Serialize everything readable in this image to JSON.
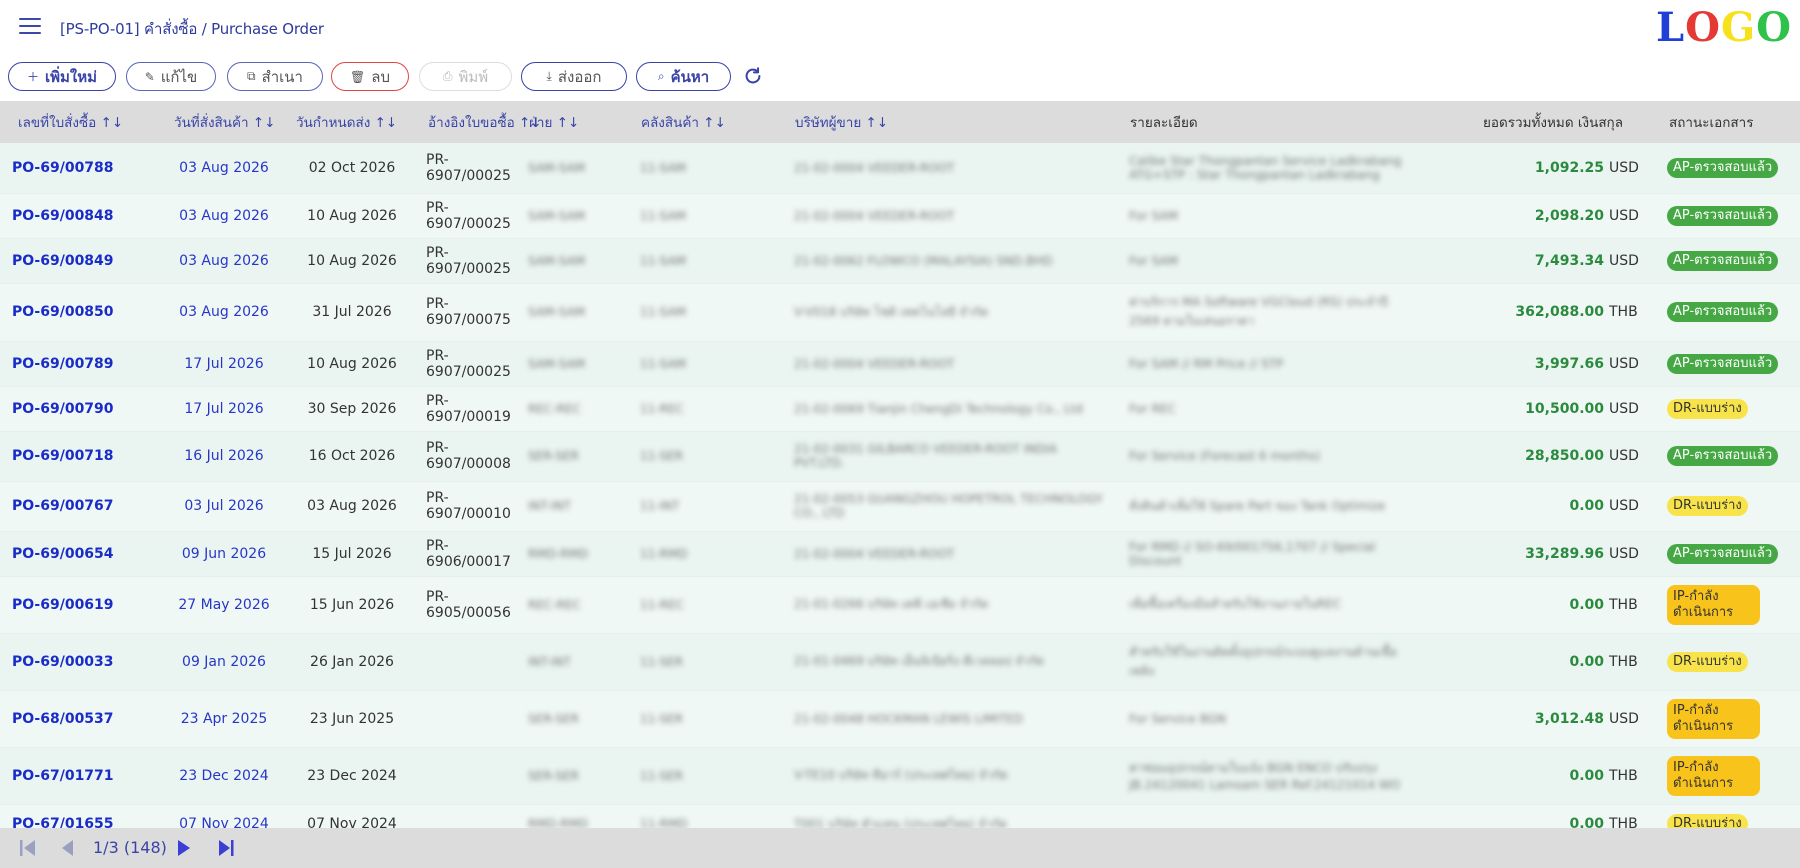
{
  "header": {
    "title": "[PS-PO-01] คำสั่งซื้อ / Purchase Order",
    "logo_letters": [
      "L",
      "O",
      "G",
      "O"
    ],
    "logo_colors": [
      "#1f3fd6",
      "#e53935",
      "#f7e11a",
      "#2fc24a"
    ]
  },
  "toolbar": {
    "add_label": "เพิ่มใหม่",
    "edit_label": "แก้ไข",
    "copy_label": "สำเนา",
    "delete_label": "ลบ",
    "print_label": "พิมพ์",
    "export_label": "ส่งออก",
    "search_label": "ค้นหา"
  },
  "table": {
    "columns": [
      "เลขที่ใบสั่งซื้อ ↑↓",
      "วันที่สั่งสินค้า ↑↓",
      "วันกำหนดส่ง ↑↓",
      "อ้างอิงใบขอซื้อ ↑↓",
      "ฝ่าย ↑↓",
      "คลังสินค้า ↑↓",
      "บริษัทผู้ขาย ↑↓",
      "รายละเอียด",
      "ยอดรวมทั้งหมด เงินสกุล",
      "สถานะเอกสาร"
    ],
    "rows": [
      {
        "po": "PO-69/00788",
        "date": "03 Aug 2026",
        "due": "02 Oct 2026",
        "pr": "PR-6907/00025",
        "dept": "SAM-SAM",
        "wh": "11-SAM",
        "vendor": "21-02-0004 VEEDER-ROOT",
        "detail": "Calibe Star Thongpantan Service Ladkrabang ATG+STP : Star Thongpantan Ladkrabang",
        "amount": "1,092.25",
        "cur": "USD",
        "status": "AP-ตรวจสอบแล้ว",
        "stype": "ap"
      },
      {
        "po": "PO-69/00848",
        "date": "03 Aug 2026",
        "due": "10 Aug 2026",
        "pr": "PR-6907/00025",
        "dept": "SAM-SAM",
        "wh": "11-SAM",
        "vendor": "21-02-0004 VEEDER-ROOT",
        "detail": "For SAM",
        "amount": "2,098.20",
        "cur": "USD",
        "status": "AP-ตรวจสอบแล้ว",
        "stype": "ap"
      },
      {
        "po": "PO-69/00849",
        "date": "03 Aug 2026",
        "due": "10 Aug 2026",
        "pr": "PR-6907/00025",
        "dept": "SAM-SAM",
        "wh": "11-SAM",
        "vendor": "21-02-0062 FLOWCO (MALAYSIA) SND.BHD",
        "detail": "For SAM",
        "amount": "7,493.34",
        "cur": "USD",
        "status": "AP-ตรวจสอบแล้ว",
        "stype": "ap"
      },
      {
        "po": "PO-69/00850",
        "date": "03 Aug 2026",
        "due": "31 Jul 2026",
        "pr": "PR-6907/00075",
        "dept": "SAM-SAM",
        "wh": "11-SAM",
        "vendor": "V-V018 บริษัท โชติ เทคโนโลยี จำกัด",
        "detail": "ค่าบริการ MA Software VGCloud (RS) ประจำปี 2569 ตามใบเสนอราคา",
        "amount": "362,088.00",
        "cur": "THB",
        "status": "AP-ตรวจสอบแล้ว",
        "stype": "ap"
      },
      {
        "po": "PO-69/00789",
        "date": "17 Jul 2026",
        "due": "10 Aug 2026",
        "pr": "PR-6907/00025",
        "dept": "SAM-SAM",
        "wh": "11-SAM",
        "vendor": "21-02-0004 VEEDER-ROOT",
        "detail": "For SAM // RM Price // STP",
        "amount": "3,997.66",
        "cur": "USD",
        "status": "AP-ตรวจสอบแล้ว",
        "stype": "ap"
      },
      {
        "po": "PO-69/00790",
        "date": "17 Jul 2026",
        "due": "30 Sep 2026",
        "pr": "PR-6907/00019",
        "dept": "REC-REC",
        "wh": "11-REC",
        "vendor": "21-02-0069 Tianjin ChengDi Technology Co., Ltd",
        "detail": "For REC",
        "amount": "10,500.00",
        "cur": "USD",
        "status": "DR-แบบร่าง",
        "stype": "dr"
      },
      {
        "po": "PO-69/00718",
        "date": "16 Jul 2026",
        "due": "16 Oct 2026",
        "pr": "PR-6907/00008",
        "dept": "SER-SER",
        "wh": "11-SER",
        "vendor": "21-02-0031 GILBARCO VEEDER-ROOT INDIA PVT.LTD.",
        "detail": "For Service (Forecast 6 months)",
        "amount": "28,850.00",
        "cur": "USD",
        "status": "AP-ตรวจสอบแล้ว",
        "stype": "ap"
      },
      {
        "po": "PO-69/00767",
        "date": "03 Jul 2026",
        "due": "03 Aug 2026",
        "pr": "PR-6907/00010",
        "dept": "INT-INT",
        "wh": "11-INT",
        "vendor": "21-02-0053 GUANGZHOU HOPETROL TECHNOLOGY CO., LTD",
        "detail": "สั่งสินค้าเพื่อใช้ Spare Part ของ Tank Optimize",
        "amount": "0.00",
        "cur": "USD",
        "status": "DR-แบบร่าง",
        "stype": "dr"
      },
      {
        "po": "PO-69/00654",
        "date": "09 Jun 2026",
        "due": "15 Jul 2026",
        "pr": "PR-6906/00017",
        "dept": "RMD-RMD",
        "wh": "11-RMD",
        "vendor": "21-02-0004 VEEDER-ROOT",
        "detail": "For RMD // SO-69/001756,1707 // Special Discount",
        "amount": "33,289.96",
        "cur": "USD",
        "status": "AP-ตรวจสอบแล้ว",
        "stype": "ap"
      },
      {
        "po": "PO-69/00619",
        "date": "27 May 2026",
        "due": "15 Jun 2026",
        "pr": "PR-6905/00056",
        "dept": "REC-REC",
        "wh": "11-REC",
        "vendor": "21-01-0266 บริษัท เคพี เอเชีย จำกัด",
        "detail": "เพื่อซื้อเครื่องมือสำหรับใช้งานภายในREC",
        "amount": "0.00",
        "cur": "THB",
        "status": "IP-กำลังดำเนินการ",
        "stype": "ip"
      },
      {
        "po": "PO-69/00033",
        "date": "09 Jan 2026",
        "due": "26 Jan 2026",
        "pr": "",
        "dept": "INT-INT",
        "wh": "11-SER",
        "vendor": "21-01-0469 บริษัท เอ็นจิเนียริ่ง ดีเวลลอป จำกัด",
        "detail": "สำหรับใช้ในงานติดตั้งอุปกรณ์ระบบดูแลงานด้านเชื้อเพลิง",
        "amount": "0.00",
        "cur": "THB",
        "status": "DR-แบบร่าง",
        "stype": "dr"
      },
      {
        "po": "PO-68/00537",
        "date": "23 Apr 2025",
        "due": "23 Jun 2025",
        "pr": "",
        "dept": "SER-SER",
        "wh": "11-SER",
        "vendor": "21-02-0048 HOCKMAN LEWIS LIMITED",
        "detail": "For Service BGN",
        "amount": "3,012.48",
        "cur": "USD",
        "status": "IP-กำลังดำเนินการ",
        "stype": "ip"
      },
      {
        "po": "PO-67/01771",
        "date": "23 Dec 2024",
        "due": "23 Dec 2024",
        "pr": "",
        "dept": "SER-SER",
        "wh": "11-SER",
        "vendor": "V-TE10 บริษัท ทีอาร์ (ประเทศไทย) จำกัด",
        "detail": "ค่าซ่อมอุปกรณ์ตามใบแจ้ง BGN ENCO ปรับปรุง JB.24120041 Lamsam SER Ref.24121014 WO",
        "amount": "0.00",
        "cur": "THB",
        "status": "IP-กำลังดำเนินการ",
        "stype": "ip"
      },
      {
        "po": "PO-67/01655",
        "date": "07 Nov 2024",
        "due": "07 Nov 2024",
        "pr": "",
        "dept": "RMD-RMD",
        "wh": "11-RMD",
        "vendor": "T001 บริษัท ตัวแทน (ประเทศไทย) จำกัด",
        "detail": "",
        "amount": "0.00",
        "cur": "THB",
        "status": "DR-แบบร่าง",
        "stype": "dr"
      }
    ]
  },
  "pagination": {
    "info": "1/3 (148)"
  }
}
